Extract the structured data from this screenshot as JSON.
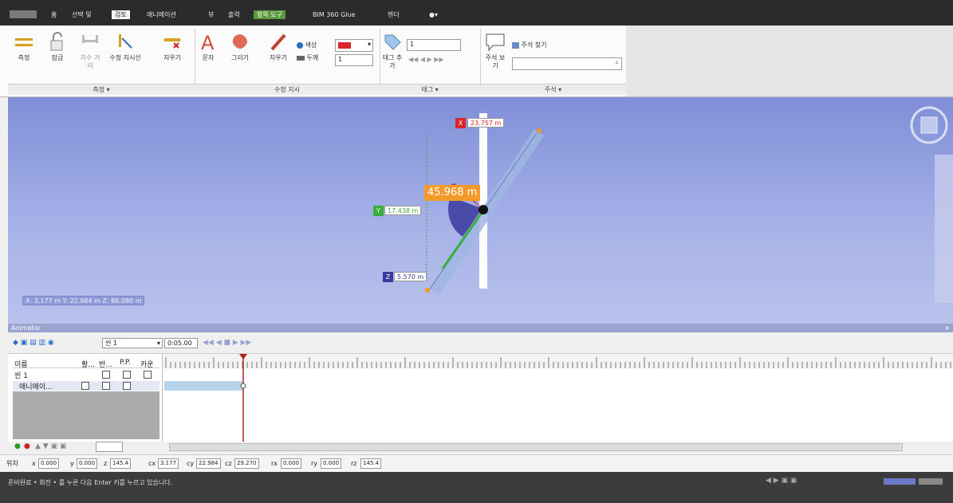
{
  "menubar": {
    "tabs": [
      "홈",
      "선택 및",
      "검토",
      "애니메이션",
      "뷰",
      "출력",
      "항목 도구",
      "BIM 360 Glue",
      "렌더"
    ],
    "active_tab": "검토",
    "context_tab": "항목 도구"
  },
  "ribbon": {
    "measure_group": {
      "buttons": [
        "측정",
        "잠금",
        "치수 거리",
        "수정 지시선",
        "지우기"
      ],
      "label": "측정 ▾"
    },
    "redline_group": {
      "buttons": [
        "문자",
        "그리기",
        "지우기"
      ],
      "color_label": "색상",
      "thickness_label": "두께",
      "thickness_value": "1",
      "label": "수정 지시"
    },
    "tags_group": {
      "add_tag": "태그 추가",
      "tag_value": "1",
      "label": "태그 ▾"
    },
    "comments_group": {
      "find_comments": "주석 찾기",
      "view_comments": "주석 보기",
      "label": "주석 ▾"
    }
  },
  "viewport": {
    "x_value": "23.757 m",
    "distance_value": "45.968 m",
    "y_value": "17.438 m",
    "z_value": "5.570 m",
    "coordinates": "X: 3.177 m  Y: 22.984 m  Z: 86.080 m"
  },
  "animator": {
    "title": "Animator",
    "scene_select": "씬 1",
    "time_field": "0:05.00",
    "columns": [
      "이름",
      "활...",
      "반...",
      "P.P.",
      "카운"
    ],
    "rows": [
      {
        "name": "씬 1"
      },
      {
        "name": "애니메이..."
      }
    ]
  },
  "coordbar": {
    "position_label": "위치",
    "x": "0.000",
    "y": "0.000",
    "z": "145.4",
    "cx": "3.177",
    "cy": "22.984",
    "cz": "29.270",
    "rx": "0.000",
    "ry": "0.000",
    "rz": "145.4"
  },
  "status": {
    "message": "준비완료 • 회전 • 를 누른 다음 Enter 키를 누르고 있습니다."
  },
  "colors": {
    "x_axis": "#d8262c",
    "y_axis": "#3aae3a",
    "z_axis": "#3a3aa0",
    "distance": "#f39a2a"
  }
}
